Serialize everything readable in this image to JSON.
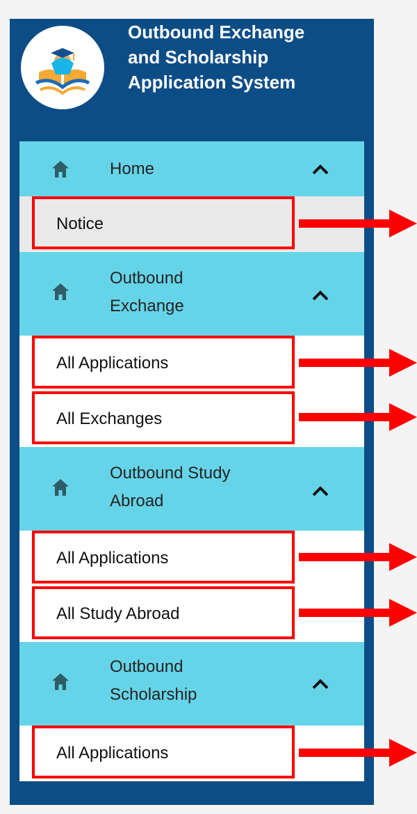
{
  "app": {
    "title_lines": [
      "Outbound Exchange",
      "and Scholarship",
      "Application System"
    ],
    "logo_icon": "graduate-book-logo"
  },
  "sections": [
    {
      "label_lines": [
        "Home"
      ],
      "icon": "home-icon",
      "chevron": "chevron-up-icon",
      "items": [
        {
          "label": "Notice",
          "active": true,
          "highlighted": true
        }
      ]
    },
    {
      "label_lines": [
        "Outbound",
        "Exchange"
      ],
      "icon": "home-icon",
      "chevron": "chevron-up-icon",
      "items": [
        {
          "label": "All Applications",
          "active": false,
          "highlighted": true
        },
        {
          "label": "All Exchanges",
          "active": false,
          "highlighted": true
        }
      ]
    },
    {
      "label_lines": [
        "Outbound Study",
        "Abroad"
      ],
      "icon": "home-icon",
      "chevron": "chevron-up-icon",
      "items": [
        {
          "label": "All Applications",
          "active": false,
          "highlighted": true
        },
        {
          "label": "All Study Abroad",
          "active": false,
          "highlighted": true
        }
      ]
    },
    {
      "label_lines": [
        "Outbound",
        "Scholarship"
      ],
      "icon": "home-icon",
      "chevron": "chevron-up-icon",
      "items": [
        {
          "label": "All Applications",
          "active": false,
          "highlighted": true
        }
      ]
    }
  ],
  "colors": {
    "page_background": "#f4f4f4",
    "sidebar_background": "#0d4d86",
    "section_header": "#66d4e8",
    "active_item": "#e9e9e9",
    "item_background": "#ffffff",
    "highlight": "#ff0000",
    "arrow": "#ff0000",
    "icon": "#2e5d67"
  }
}
